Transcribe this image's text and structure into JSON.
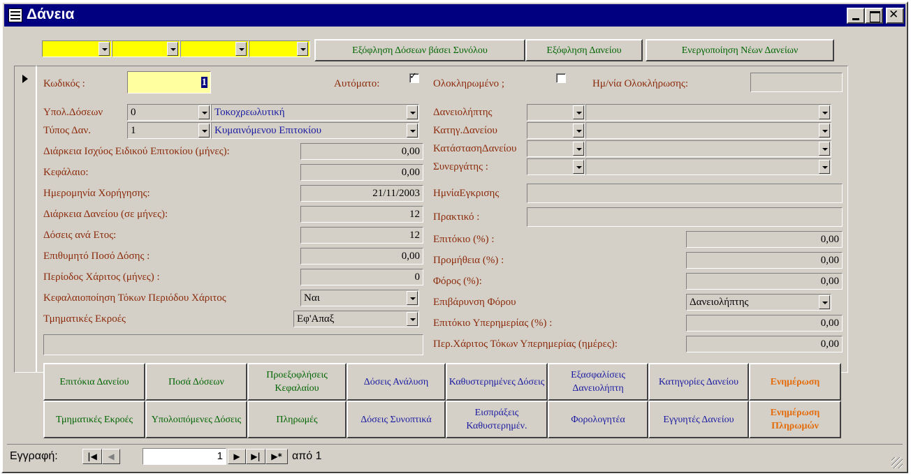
{
  "window": {
    "title": "Δάνεια"
  },
  "toolbar": {
    "btn_sum": "Εξόφληση Δόσεων βάσει Συνόλου",
    "btn_loan": "Εξόφληση Δανείου",
    "btn_activate": "Ενεργοποίηση Νέων Δανείων"
  },
  "form": {
    "code_label": "Κωδικός :",
    "code_value": "1",
    "auto_label": "Αυτόματο:",
    "completed_label": "Ολοκληρωμένο ;",
    "completed_date_label": "Ημ/νία Ολοκλήρωσης:",
    "calc_label": "Υπολ.Δόσεων",
    "calc_value": "0",
    "calc_text": "Τοκοχρεωλυτική",
    "type_label": "Τύπος Δαν.",
    "type_value": "1",
    "type_text": "Κυμαινόμενου Επιτοκίου",
    "special_rate_label": "Διάρκεια Ισχύος Ειδικού Επιτοκίου (μήνες):",
    "special_rate_value": "0,00",
    "capital_label": "Κεφάλαιο:",
    "capital_value": "0,00",
    "grant_date_label": "Ημερομηνία Χορήγησης:",
    "grant_date_value": "21/11/2003",
    "duration_label": "Διάρκεια Δανείου (σε μήνες):",
    "duration_value": "12",
    "per_year_label": "Δόσεις ανά Ετος:",
    "per_year_value": "12",
    "desired_label": "Επιθυμητό Ποσό Δόσης :",
    "desired_value": "0,00",
    "grace_label": "Περίοδος Χάριτος (μήνες) :",
    "grace_value": "0",
    "capitalize_label": "Κεφαλαιοποίηση Τόκων Περιόδου Χάριτος",
    "capitalize_value": "Ναι",
    "flows_label": "Τμηματικές Εκροές",
    "flows_value": "Εφ'Απαξ",
    "borrower_label": "Δανειολήπτης",
    "category_label": "Κατηγ.Δανείου",
    "status_label": "ΚατάστασηΔανείου",
    "partner_label": "Συνεργάτης :",
    "approval_label": "ΗμνίαΕγκρισης",
    "minutes_label": "Πρακτικό :",
    "rate_label": "Επιτόκιο (%) :",
    "rate_value": "0,00",
    "commission_label": "Προμήθεια (%) :",
    "commission_value": "0,00",
    "tax_label": "Φόρος (%):",
    "tax_value": "0,00",
    "tax_charge_label": "Επιβάρυνση Φόρου",
    "tax_charge_value": "Δανειολήπτης",
    "overdue_rate_label": "Επιτόκιο Υπερημερίας (%) :",
    "overdue_rate_value": "0,00",
    "overdue_grace_label": "Περ.Χάριτος Τόκων Υπερημερίας (ημέρες):",
    "overdue_grace_value": "0,00"
  },
  "buttons": {
    "b1": "Επιτόκια Δανείου",
    "b2": "Ποσά Δόσεων",
    "b3": "Προεξοφλήσεις Κεφαλαίου",
    "b4": "Δόσεις Ανάλυση",
    "b5": "Καθυστερημένες Δόσεις",
    "b6": "Εξασφαλίσεις Δανειολήπτη",
    "b7": "Κατηγορίες Δανείου",
    "b8": "Ενημέρωση",
    "c1": "Τμηματικές Εκροές",
    "c2": "Υπολοιπόμενες Δόσεις",
    "c3": "Πληρωμές",
    "c4": "Δόσεις Συνοπτικά",
    "c5": "Εισπράξεις Καθυστερημέν.",
    "c6": "Φορολογητέα",
    "c7": "Εγγυητές Δανείου",
    "c8": "Ενημέρωση Πληρωμών"
  },
  "navigation": {
    "record_label": "Εγγραφή:",
    "current": "1",
    "of_label": "από 1"
  },
  "colors": {
    "title_bar": "#000080",
    "yellow": "#ffff00",
    "label": "#8b2a0a",
    "green_button": "#006400",
    "orange_button": "#e46c0a"
  }
}
